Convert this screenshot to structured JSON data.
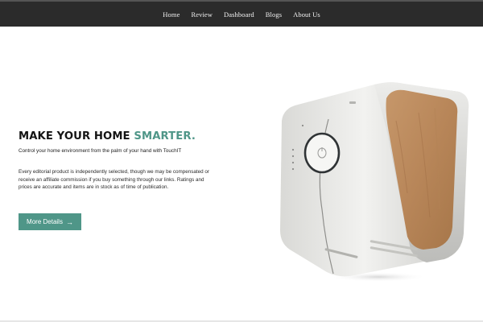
{
  "nav": {
    "items": [
      {
        "label": "Home"
      },
      {
        "label": "Review"
      },
      {
        "label": "Dashboard"
      },
      {
        "label": "Blogs"
      },
      {
        "label": "About Us"
      }
    ]
  },
  "hero": {
    "title_main": "MAKE YOUR HOME ",
    "title_accent": "SMARTER.",
    "subtitle": "Control your home environment from the palm of your hand with TouchIT",
    "description": "Every editorial product is independently selected, though we may be compensated or receive an affiliate commission if you buy something through our links. Ratings and prices are accurate and items are in stock as of time of publication.",
    "cta_label": "More Details"
  },
  "colors": {
    "accent": "#4f9688",
    "navbar": "#2b2b2b"
  },
  "icons": {
    "cta": "arrow-right-icon"
  }
}
